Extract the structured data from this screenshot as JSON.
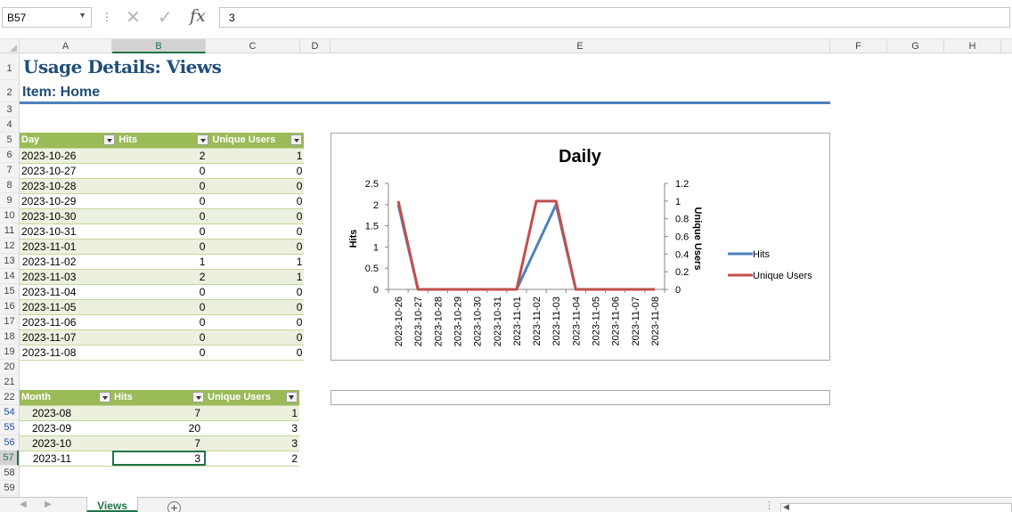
{
  "formula_bar": {
    "name_box": "B57",
    "formula": "3",
    "fx_label": "fx"
  },
  "columns": [
    "A",
    "B",
    "C",
    "D",
    "E",
    "F",
    "G",
    "H"
  ],
  "rows": [
    "1",
    "2",
    "3",
    "4",
    "5",
    "6",
    "7",
    "8",
    "9",
    "10",
    "11",
    "12",
    "13",
    "14",
    "15",
    "16",
    "17",
    "18",
    "19",
    "20",
    "21",
    "22",
    "54",
    "55",
    "56",
    "57",
    "58",
    "59"
  ],
  "title": "Usage Details: Views",
  "subtitle": "Item: Home",
  "daily_table": {
    "headers": [
      "Day",
      "Hits",
      "Unique Users"
    ],
    "rows": [
      [
        "2023-10-26",
        "2",
        "1"
      ],
      [
        "2023-10-27",
        "0",
        "0"
      ],
      [
        "2023-10-28",
        "0",
        "0"
      ],
      [
        "2023-10-29",
        "0",
        "0"
      ],
      [
        "2023-10-30",
        "0",
        "0"
      ],
      [
        "2023-10-31",
        "0",
        "0"
      ],
      [
        "2023-11-01",
        "0",
        "0"
      ],
      [
        "2023-11-02",
        "1",
        "1"
      ],
      [
        "2023-11-03",
        "2",
        "1"
      ],
      [
        "2023-11-04",
        "0",
        "0"
      ],
      [
        "2023-11-05",
        "0",
        "0"
      ],
      [
        "2023-11-06",
        "0",
        "0"
      ],
      [
        "2023-11-07",
        "0",
        "0"
      ],
      [
        "2023-11-08",
        "0",
        "0"
      ]
    ]
  },
  "monthly_table": {
    "headers": [
      "Month",
      "Hits",
      "Unique Users"
    ],
    "rows": [
      [
        "2023-08",
        "7",
        "1"
      ],
      [
        "2023-09",
        "20",
        "3"
      ],
      [
        "2023-10",
        "7",
        "3"
      ],
      [
        "2023-11",
        "3",
        "2"
      ]
    ]
  },
  "chart_data": {
    "type": "line",
    "title": "Daily",
    "categories": [
      "2023-10-26",
      "2023-10-27",
      "2023-10-28",
      "2023-10-29",
      "2023-10-30",
      "2023-10-31",
      "2023-11-01",
      "2023-11-02",
      "2023-11-03",
      "2023-11-04",
      "2023-11-05",
      "2023-11-06",
      "2023-11-07",
      "2023-11-08"
    ],
    "series": [
      {
        "name": "Hits",
        "axis": "left",
        "color": "#4f81bd",
        "values": [
          2,
          0,
          0,
          0,
          0,
          0,
          0,
          1,
          2,
          0,
          0,
          0,
          0,
          0
        ]
      },
      {
        "name": "Unique Users",
        "axis": "right",
        "color": "#c0504d",
        "values": [
          1,
          0,
          0,
          0,
          0,
          0,
          0,
          1,
          1,
          0,
          0,
          0,
          0,
          0
        ]
      }
    ],
    "ylabel": "Hits",
    "y2label": "Unique Users",
    "ylim": [
      0,
      2.5
    ],
    "y2lim": [
      0,
      1.2
    ],
    "yticks": [
      "0",
      "0.5",
      "1",
      "1.5",
      "2",
      "2.5"
    ],
    "y2ticks": [
      "0",
      "0.2",
      "0.4",
      "0.6",
      "0.8",
      "1",
      "1.2"
    ],
    "legend": "right",
    "grid": false
  },
  "sheet_tabs": [
    {
      "label": "Views",
      "active": true
    }
  ],
  "add_sheet_label": "+"
}
